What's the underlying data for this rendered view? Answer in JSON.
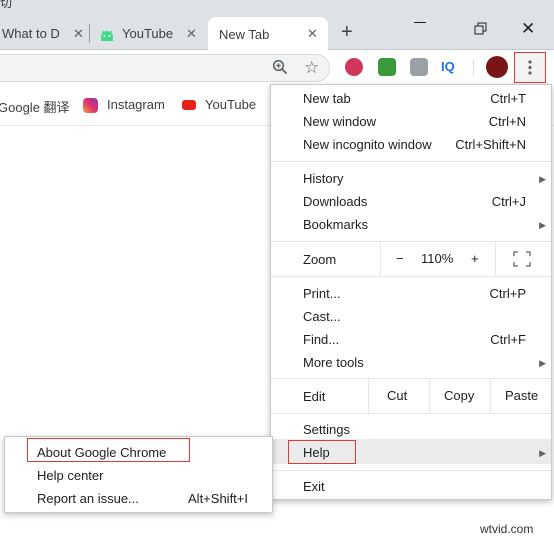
{
  "window": {
    "title_glyph": "切",
    "new_tab_symbol": "+",
    "close_symbol": "✕"
  },
  "tabs": [
    {
      "label": "What to D",
      "close": "✕",
      "active": false
    },
    {
      "label": "YouTube",
      "close": "✕",
      "active": false,
      "favicon": "android-icon"
    },
    {
      "label": "New Tab",
      "close": "✕",
      "active": true
    }
  ],
  "toolbar": {
    "zoom_icon": "magnifier-icon",
    "star_icon": "star-outline-icon",
    "extensions": [
      "pocket-icon",
      "honey-icon",
      "tb-icon",
      "IQ"
    ],
    "menu_icon": "kebab-menu-icon"
  },
  "bookmarks": [
    {
      "label": "Google 翻译"
    },
    {
      "label": "Instagram",
      "icon": "instagram-icon"
    },
    {
      "label": "YouTube",
      "icon": "youtube-icon"
    }
  ],
  "menu": {
    "new_tab": "New tab",
    "new_tab_sc": "Ctrl+T",
    "new_window": "New window",
    "new_window_sc": "Ctrl+N",
    "incognito": "New incognito window",
    "incognito_sc": "Ctrl+Shift+N",
    "history": "History",
    "downloads": "Downloads",
    "downloads_sc": "Ctrl+J",
    "bookmarks": "Bookmarks",
    "zoom": "Zoom",
    "zoom_minus": "−",
    "zoom_value": "110%",
    "zoom_plus": "+",
    "print": "Print...",
    "print_sc": "Ctrl+P",
    "cast": "Cast...",
    "find": "Find...",
    "find_sc": "Ctrl+F",
    "more_tools": "More tools",
    "edit": "Edit",
    "cut": "Cut",
    "copy": "Copy",
    "paste": "Paste",
    "settings": "Settings",
    "help": "Help",
    "exit": "Exit",
    "submenu_arrow": "▶"
  },
  "help_menu": {
    "about": "About Google Chrome",
    "help_center": "Help center",
    "report": "Report an issue...",
    "report_sc": "Alt+Shift+I"
  },
  "watermark": "wtvid.com",
  "colors": {
    "highlight_border": "#e53935",
    "tab_strip": "#dee1e6"
  }
}
